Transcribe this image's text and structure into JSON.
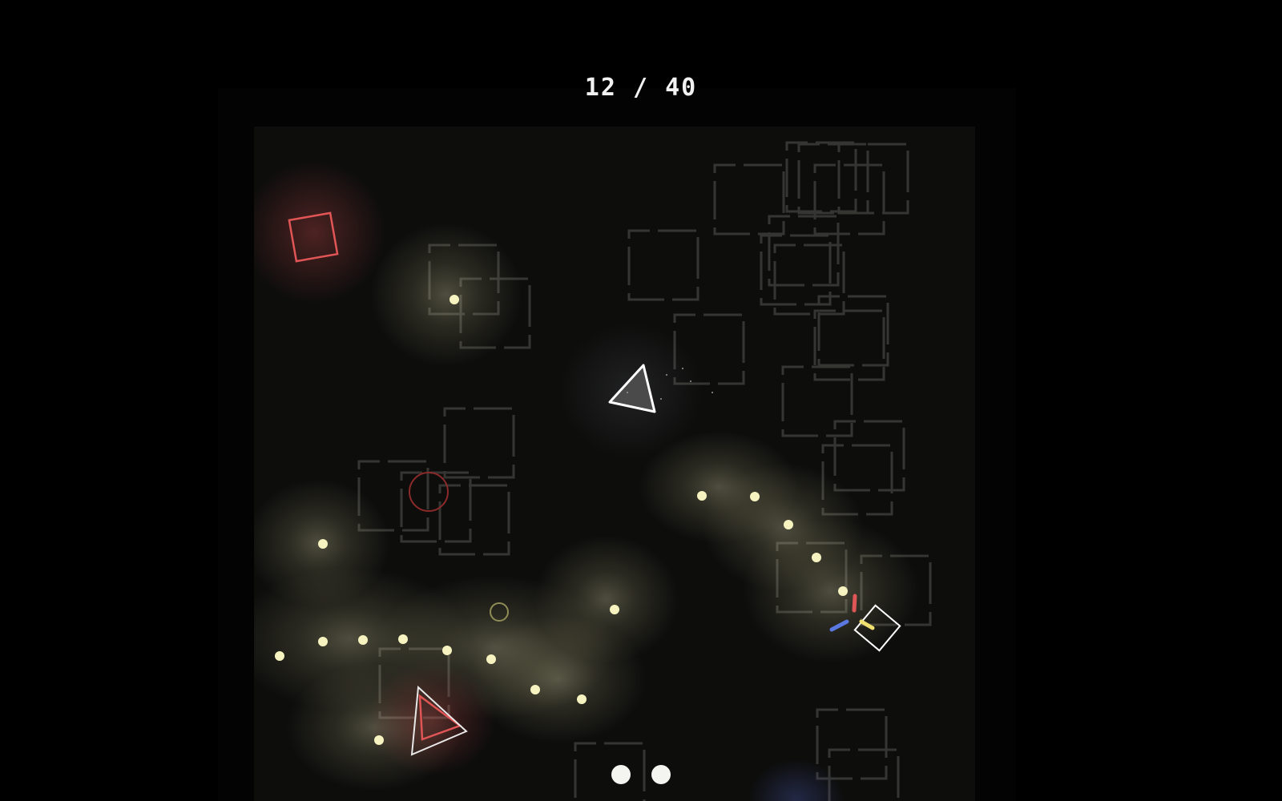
{
  "hud": {
    "collected": 12,
    "total": 40,
    "counter_text": "12 / 40",
    "lives_remaining": 2
  },
  "colors": {
    "background": "#000000",
    "arena": "#0d0d0c",
    "orb": "#f7f3c0",
    "orb_glow": "#fffbd0",
    "hazard": "#e05555",
    "player": "#ffffff",
    "blue_accent": "#5a78e0",
    "red_accent": "#e05555",
    "yellow_accent": "#f0e070",
    "crate_outline": "#3a3a38"
  },
  "entities": {
    "player_icon": "triangle-ship-icon",
    "enemy_icons": [
      "square-hazard-icon",
      "triangle-hazard-icon",
      "ring-hazard-icon"
    ],
    "collectible_icon": "glowing-orb-icon",
    "target_icon": "rotated-square-target-icon"
  }
}
